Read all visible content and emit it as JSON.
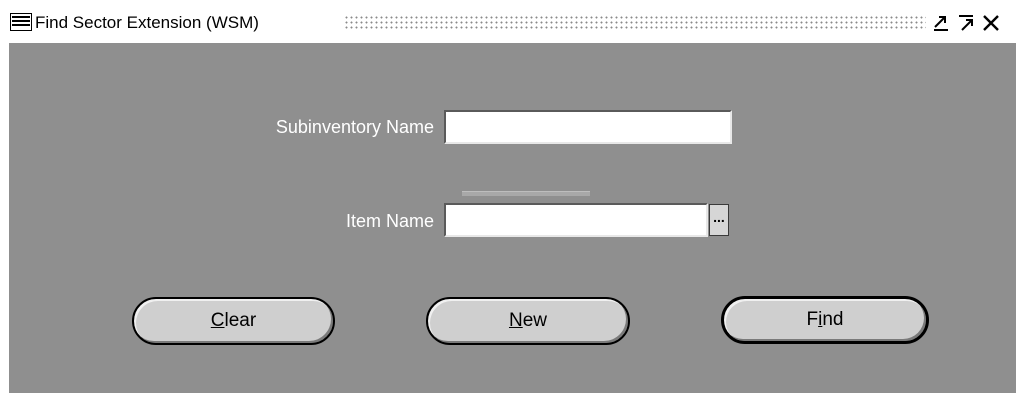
{
  "window": {
    "title": "Find Sector Extension (WSM)",
    "icons": {
      "app": "oracle-applications-icon",
      "minimize": "minimize-icon",
      "maximize": "maximize-icon",
      "close": "close-icon"
    }
  },
  "form": {
    "subinventory_label": "Subinventory Name",
    "subinventory_value": "",
    "item_label": "Item Name",
    "item_value": "",
    "lov_button": "..."
  },
  "buttons": {
    "clear_mnemonic": "C",
    "clear_rest": "lear",
    "new_mnemonic": "N",
    "new_rest": "ew",
    "find_pre": "F",
    "find_mnemonic": "i",
    "find_rest": "nd"
  },
  "colors": {
    "canvas": "#8f8f8f",
    "field": "#ffffff",
    "button": "#cfcfcf",
    "label": "#ffffff"
  }
}
